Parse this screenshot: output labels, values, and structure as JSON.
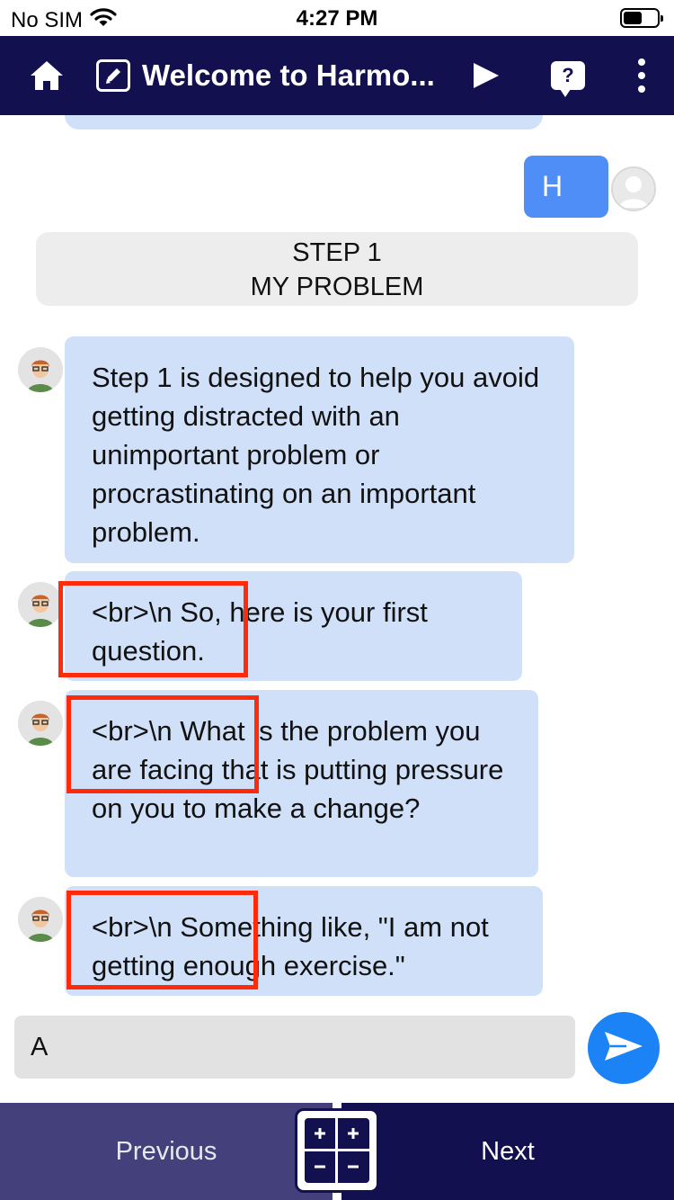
{
  "status_bar": {
    "carrier": "No SIM",
    "time": "4:27 PM"
  },
  "header": {
    "title": "Welcome to Harmo..."
  },
  "chat": {
    "user_message": "H",
    "step_card": {
      "line1": "STEP 1",
      "line2": "MY PROBLEM"
    },
    "bot_messages": [
      "Step 1 is designed to help you avoid getting distracted with an unimportant problem or procrastinating on an important problem.",
      "<br>\\n So, here is your first question.",
      "<br>\\n What is the problem you are facing that is putting pressure on you to make a change?",
      "<br>\\n Something like, \"I am not getting enough exercise.\""
    ]
  },
  "input": {
    "value": "A"
  },
  "footer": {
    "previous_label": "Previous",
    "next_label": "Next"
  },
  "colors": {
    "header_bg": "#12104f",
    "bot_bubble": "#cfe0f8",
    "user_bubble": "#4f8ef7",
    "send": "#1b83f5",
    "highlight": "#ff2b0a"
  },
  "icons": [
    "home-icon",
    "edit-icon",
    "play-icon",
    "help-icon",
    "more-icon",
    "send-icon",
    "calculator-icon",
    "wifi-icon",
    "battery-icon"
  ]
}
